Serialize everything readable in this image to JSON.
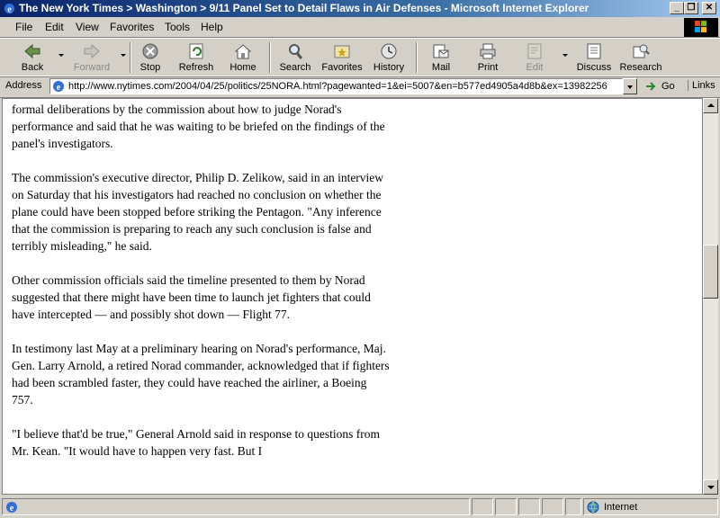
{
  "window": {
    "title": "The New York Times > Washington > 9/11 Panel Set to Detail Flaws in Air Defenses - Microsoft Internet Explorer",
    "controls": [
      "_",
      "❐",
      "✕"
    ]
  },
  "menu": {
    "items": [
      "File",
      "Edit",
      "View",
      "Favorites",
      "Tools",
      "Help"
    ]
  },
  "toolbar": {
    "back": "Back",
    "forward": "Forward",
    "stop": "Stop",
    "refresh": "Refresh",
    "home": "Home",
    "search": "Search",
    "favorites": "Favorites",
    "history": "History",
    "mail": "Mail",
    "print": "Print",
    "edit": "Edit",
    "discuss": "Discuss",
    "research": "Research"
  },
  "address": {
    "label": "Address",
    "url": "http://www.nytimes.com/2004/04/25/politics/25NORA.html?pagewanted=1&ei=5007&en=b577ed4905a4d8b&ex=13982256",
    "go": "Go",
    "links": "Links"
  },
  "article": {
    "paragraphs": [
      "formal deliberations by the commission about how to judge Norad's performance and said that he was waiting to be briefed on the findings of the panel's investigators.",
      "The commission's executive director, Philip D. Zelikow, said in an interview on Saturday that his investigators had reached no conclusion on whether the plane could have been stopped before striking the Pentagon. \"Any inference that the commission is preparing to reach any such conclusion is false and terribly misleading,\" he said.",
      "Other commission officials said the timeline presented to them by Norad suggested that there might have been time to launch jet fighters that could have intercepted — and possibly shot down — Flight 77.",
      "In testimony last May at a preliminary hearing on Norad's performance, Maj. Gen. Larry Arnold, a retired Norad commander, acknowledged that if fighters had been scrambled faster, they could have reached the airliner, a Boeing 757.",
      "\"I believe that'd be true,\" General Arnold said in response to questions from Mr. Kean. \"It would have to happen very fast. But I"
    ]
  },
  "status": {
    "zone": "Internet"
  },
  "scroll": {
    "position_fraction": 0.42
  }
}
